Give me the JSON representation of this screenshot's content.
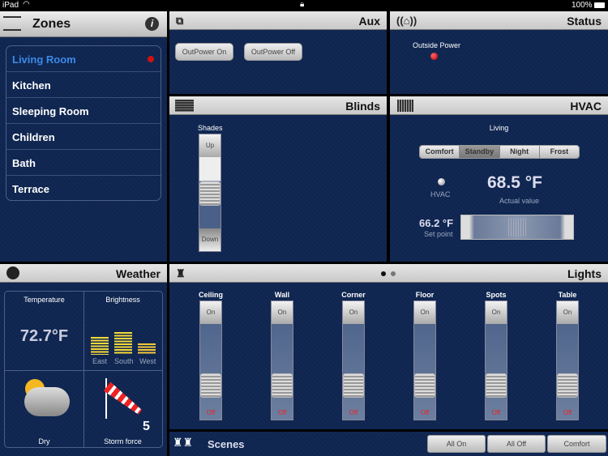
{
  "statusbar": {
    "device": "iPad",
    "battery": "100%"
  },
  "zones": {
    "title": "Zones",
    "items": [
      {
        "label": "Living Room",
        "active": true
      },
      {
        "label": "Kitchen"
      },
      {
        "label": "Sleeping Room"
      },
      {
        "label": "Children"
      },
      {
        "label": "Bath"
      },
      {
        "label": "Terrace"
      }
    ]
  },
  "aux": {
    "title": "Aux",
    "buttons": [
      "OutPower On",
      "OutPower Off"
    ]
  },
  "status": {
    "title": "Status",
    "outside_power_label": "Outside Power",
    "indicator_color": "#d01010"
  },
  "blinds": {
    "title": "Blinds",
    "shades_label": "Shades",
    "up": "Up",
    "down": "Down",
    "position_percent": 40
  },
  "hvac": {
    "title": "HVAC",
    "zone": "Living",
    "modes": [
      "Comfort",
      "Standby",
      "Night",
      "Frost"
    ],
    "selected_mode": "Standby",
    "indicator_label": "HVAC",
    "actual_value": "68.5 °F",
    "actual_label": "Actual value",
    "setpoint_value": "66.2 °F",
    "setpoint_label": "Set point"
  },
  "weather": {
    "title": "Weather",
    "temperature_label": "Temperature",
    "temperature": "72.7°F",
    "brightness_label": "Brightness",
    "brightness": [
      {
        "label": "East",
        "level": 6
      },
      {
        "label": "South",
        "level": 8
      },
      {
        "label": "West",
        "level": 4
      }
    ],
    "condition": "Dry",
    "wind_value": "5",
    "wind_label": "Storm force"
  },
  "lights": {
    "title": "Lights",
    "page": 1,
    "pages": 2,
    "on_label": "On",
    "off_label": "Off",
    "channels": [
      "Ceiling",
      "Wall",
      "Corner",
      "Floor",
      "Spots",
      "Table"
    ]
  },
  "scenes": {
    "title": "Scenes",
    "buttons": [
      "All On",
      "All Off",
      "Comfort"
    ]
  }
}
